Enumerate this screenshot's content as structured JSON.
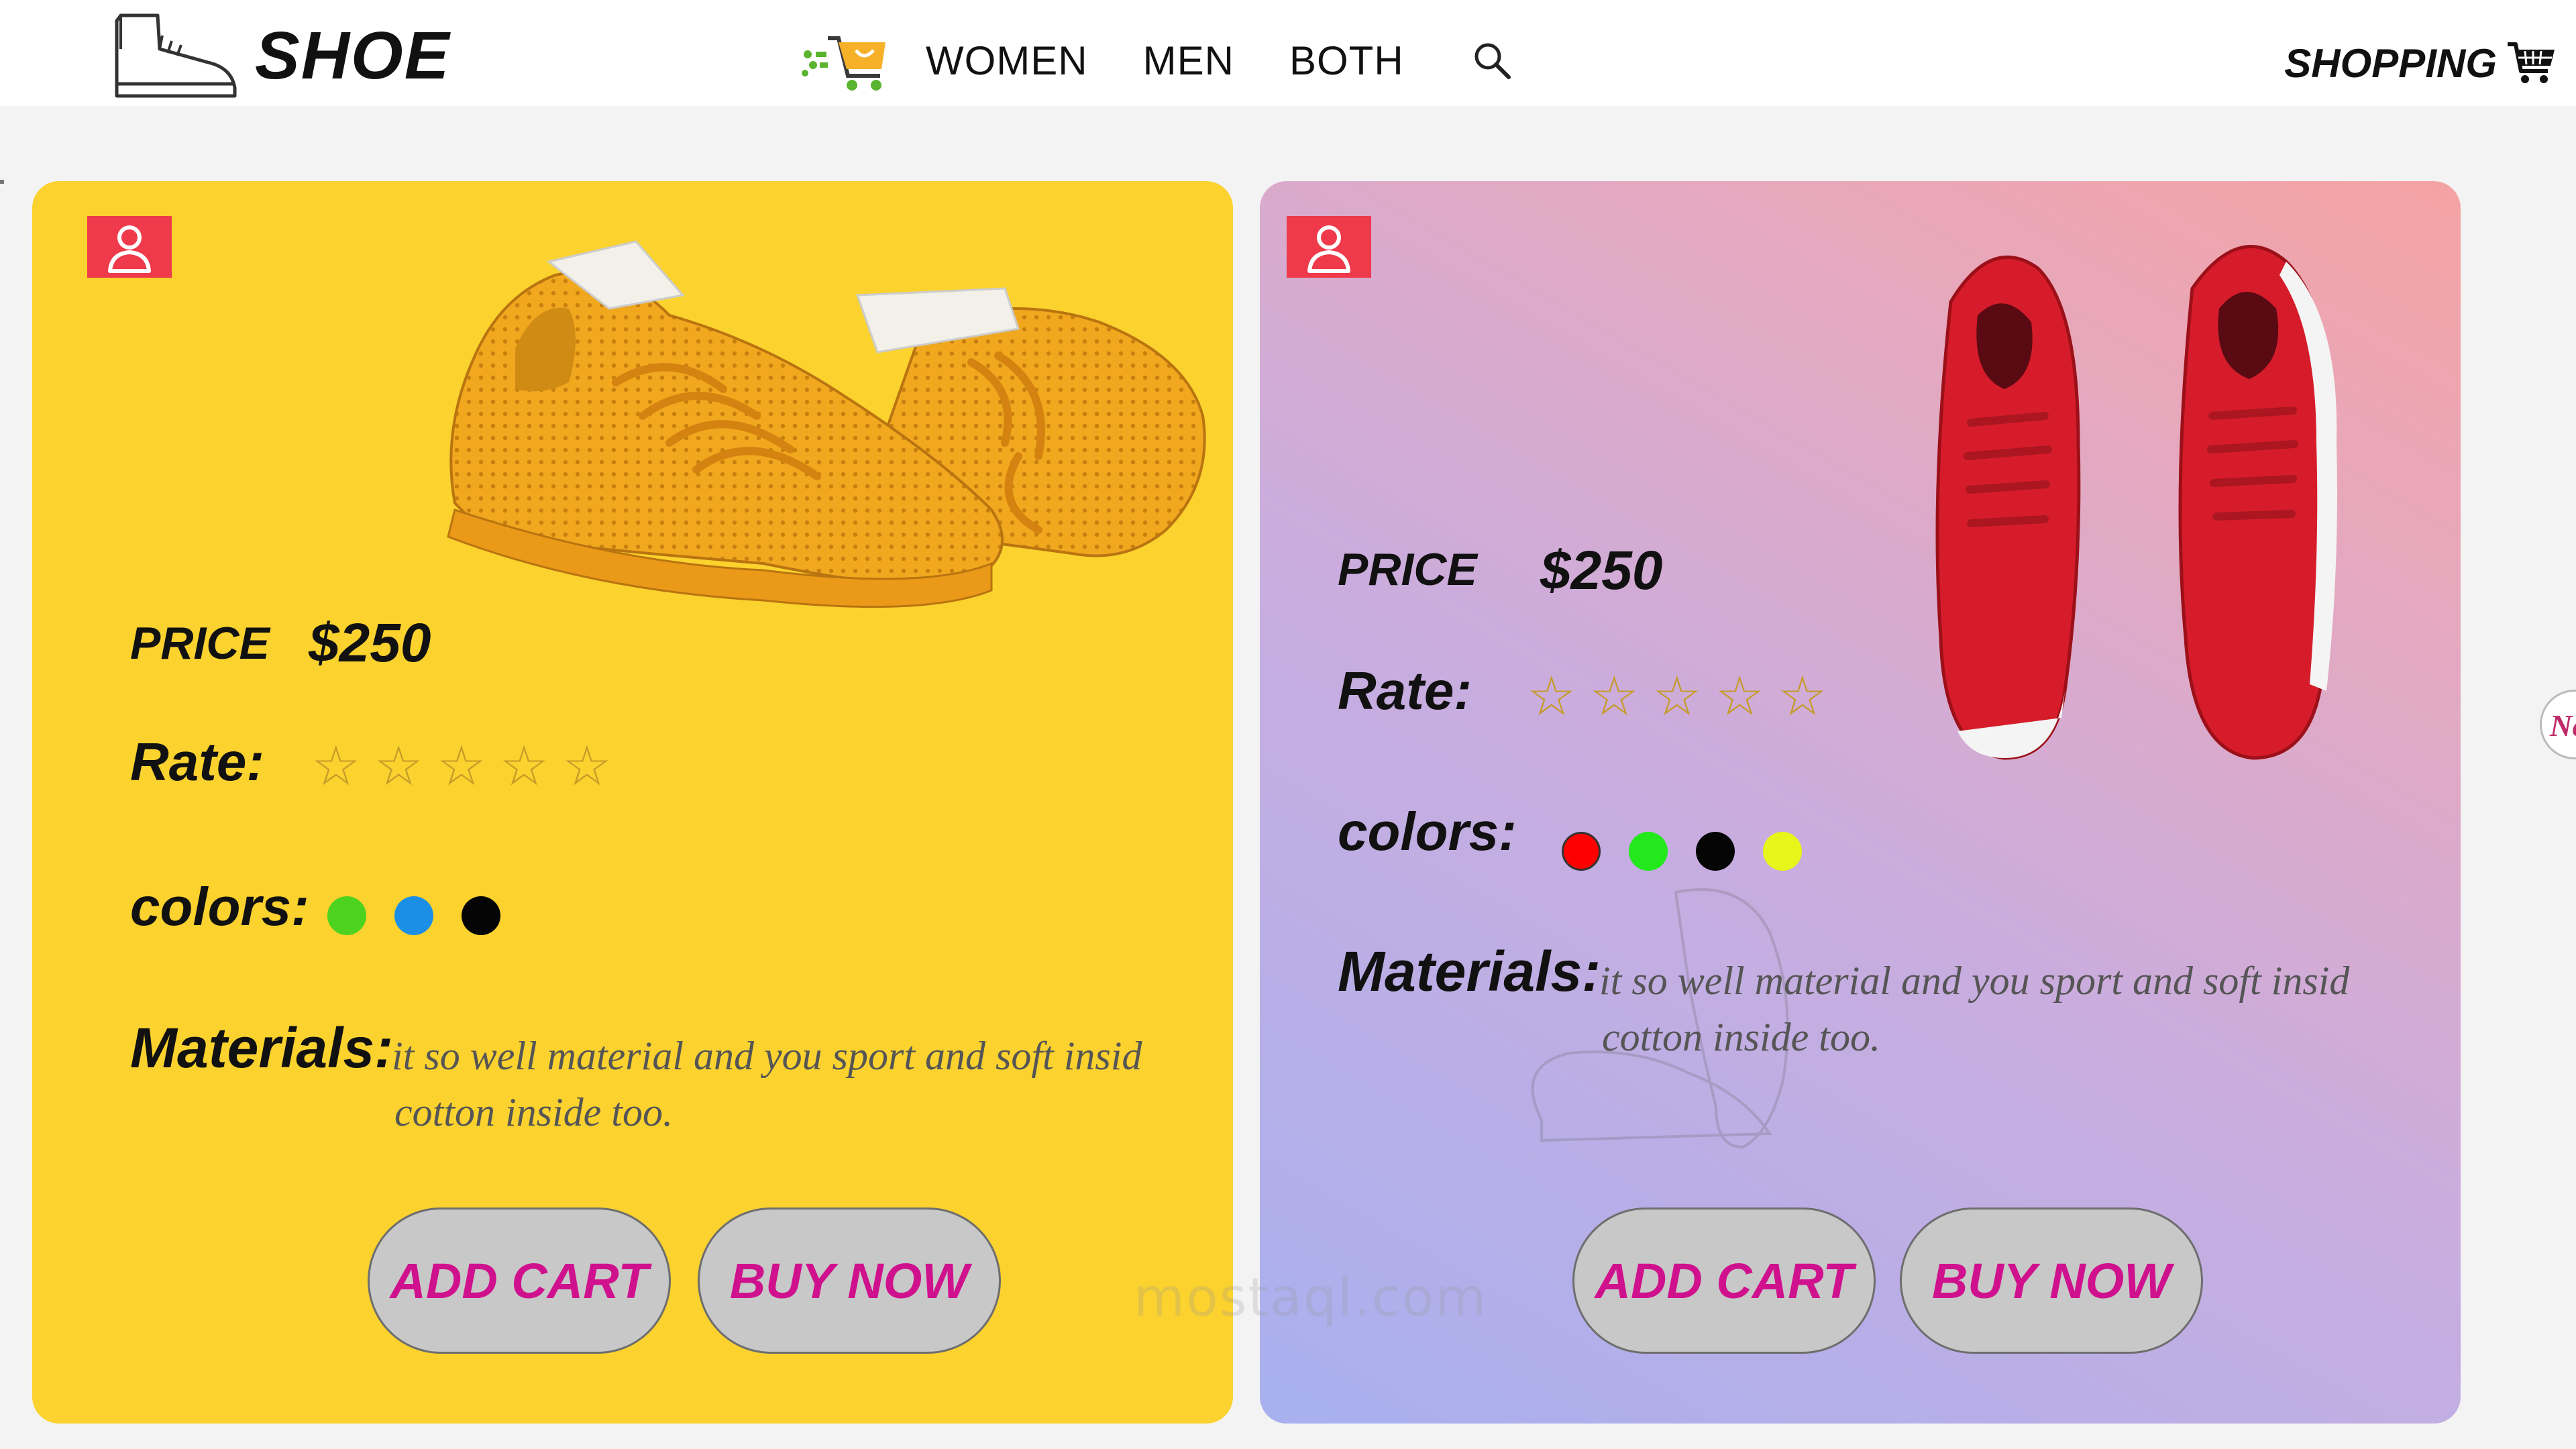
{
  "header": {
    "brand": "SHOE",
    "nav": [
      "WOMEN",
      "MEN",
      "BOTH"
    ],
    "shopping": "SHOPPING"
  },
  "cards": [
    {
      "price_label": "PRICE",
      "price": "$250",
      "rate_label": "Rate:",
      "rating": 0,
      "stars_total": 5,
      "colors_label": "colors:",
      "colors": [
        "#4cd21f",
        "#1b8fe6",
        "#050505"
      ],
      "materials_label": "Materials:",
      "materials_line1": "it so well material and you sport and soft insid",
      "materials_line2": "cotton inside too.",
      "add_cart": "ADD CART",
      "buy_now": "BUY NOW"
    },
    {
      "price_label": "PRICE",
      "price": "$250",
      "rate_label": "Rate:",
      "rating": 0,
      "stars_total": 5,
      "colors_label": "colors:",
      "colors": [
        "#ff0000",
        "#22e81c",
        "#050505",
        "#e7f51a"
      ],
      "materials_label": "Materials:",
      "materials_line1": "it so well material and you sport and soft insid",
      "materials_line2": "cotton inside too.",
      "add_cart": "ADD CART",
      "buy_now": "BUY NOW"
    }
  ],
  "next_tab": "Ne",
  "watermark": "mostaql.com",
  "theme": {
    "card_left_bg": "#fbd22e",
    "button_text": "#d0118e",
    "badge": "#ee3a4a",
    "star": "#c59b2a"
  },
  "icons": [
    "boot-icon",
    "cart-logo-icon",
    "search-icon",
    "shopping-cart-icon",
    "user-icon",
    "star-icon"
  ]
}
